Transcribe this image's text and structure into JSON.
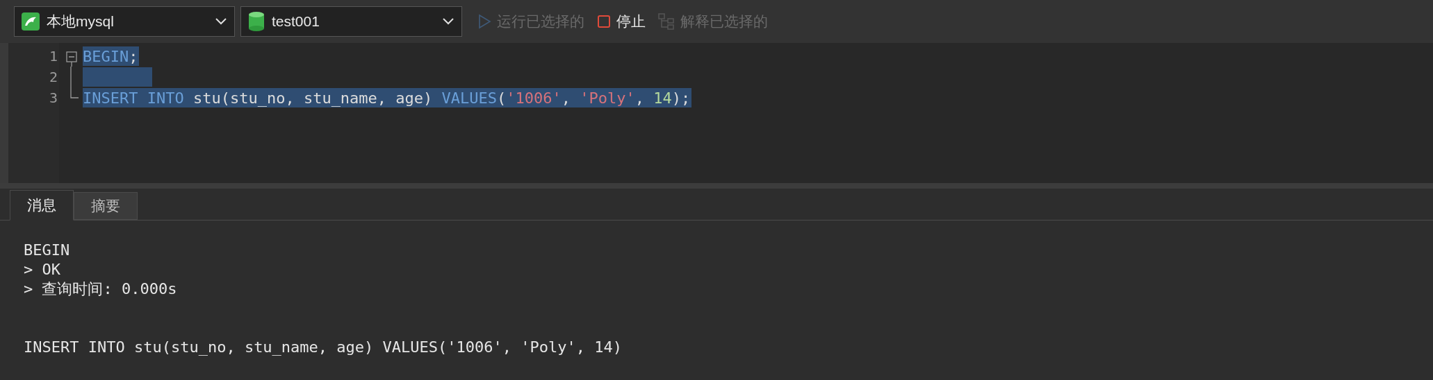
{
  "toolbar": {
    "connection": {
      "label": "本地mysql"
    },
    "database": {
      "label": "test001"
    },
    "buttons": [
      {
        "kind": "run",
        "label": "运行已选择的",
        "disabled": true
      },
      {
        "kind": "stop",
        "label": "停止",
        "disabled": false
      },
      {
        "kind": "explain",
        "label": "解释已选择的",
        "disabled": true
      }
    ]
  },
  "editor": {
    "lines": [
      {
        "number": "1",
        "kind": "fold_start",
        "selected": true,
        "tokens": [
          {
            "kind": "keyword",
            "text": "BEGIN"
          },
          {
            "kind": "plain",
            "text": ";"
          }
        ]
      },
      {
        "number": "2",
        "kind": "fold_line",
        "selected": true
      },
      {
        "number": "3",
        "kind": "fold_end",
        "selected": true,
        "tokens": [
          {
            "kind": "keyword",
            "text": "INSERT INTO"
          },
          {
            "kind": "plain",
            "text": " stu(stu_no, stu_name, age) "
          },
          {
            "kind": "keyword",
            "text": "VALUES"
          },
          {
            "kind": "plain",
            "text": "("
          },
          {
            "kind": "string",
            "text": "'1006'"
          },
          {
            "kind": "plain",
            "text": ", "
          },
          {
            "kind": "string",
            "text": "'Poly'"
          },
          {
            "kind": "plain",
            "text": ", "
          },
          {
            "kind": "number",
            "text": "14"
          },
          {
            "kind": "plain",
            "text": ");"
          }
        ]
      }
    ]
  },
  "result_tabs": [
    {
      "label": "消息",
      "selected": true
    },
    {
      "label": "摘要",
      "selected": false
    }
  ],
  "messages": [
    {
      "lines": [
        "BEGIN",
        "> OK",
        "> 查询时间: 0.000s"
      ]
    },
    {
      "lines": [
        "INSERT INTO stu(stu_no, stu_name, age) VALUES('1006', 'Poly', 14)"
      ]
    }
  ]
}
